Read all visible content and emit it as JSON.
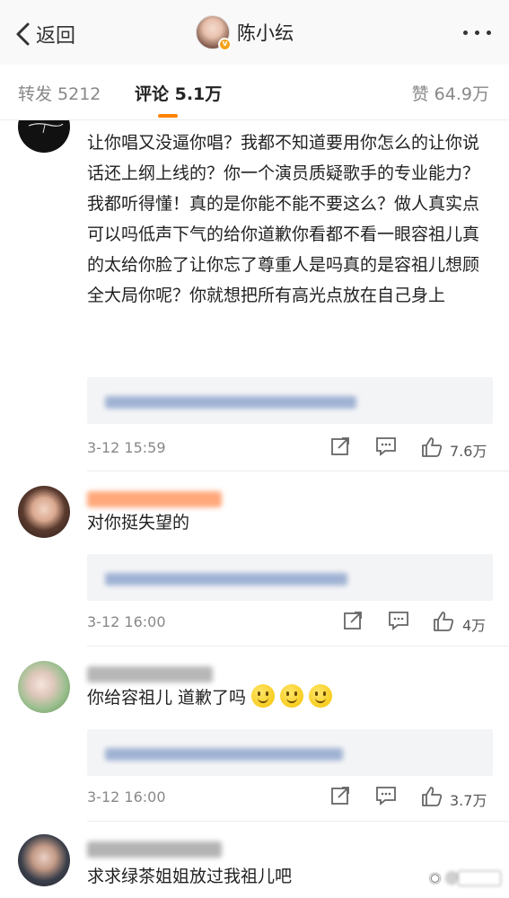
{
  "nav": {
    "back_label": "返回",
    "title": "陈小纭",
    "verified_badge": "v"
  },
  "tabs": [
    {
      "label": "转发 5212"
    },
    {
      "label": "评论 5.1万",
      "active": true
    },
    {
      "label": "赞 64.9万"
    }
  ],
  "comments": [
    {
      "text": "让你唱又没逼你唱？我都不知道要用你怎么的让你说话还上纲上线的？你一个演员质疑歌手的专业能力？我都听得懂！真的是你能不能不要这么？做人真实点可以吗低声下气的给你道歉你看都不看一眼容祖儿真的太给你脸了让你忘了尊重人是吗真的是容祖儿想顾全大局你呢？你就想把所有高光点放在自己身上",
      "time": "3-12 15:59",
      "likes": "7.6万"
    },
    {
      "text": "对你挺失望的",
      "time": "3-12 16:00",
      "likes": "4万"
    },
    {
      "text": "你给容祖儿 道歉了吗",
      "emoji_count": 3,
      "time": "3-12 16:00",
      "likes": "3.7万"
    },
    {
      "text": "求求绿茶姐姐放过我祖儿吧"
    }
  ],
  "icons": {
    "back": "chevron-left-icon",
    "more": "more-dots-icon",
    "share": "share-icon",
    "comment": "comment-icon",
    "like": "thumbs-up-icon",
    "emoji": "smile-emoji-icon"
  },
  "colors": {
    "accent": "#ff8200",
    "verify": "#f5a31a",
    "reply_bg": "#f3f4f6"
  }
}
